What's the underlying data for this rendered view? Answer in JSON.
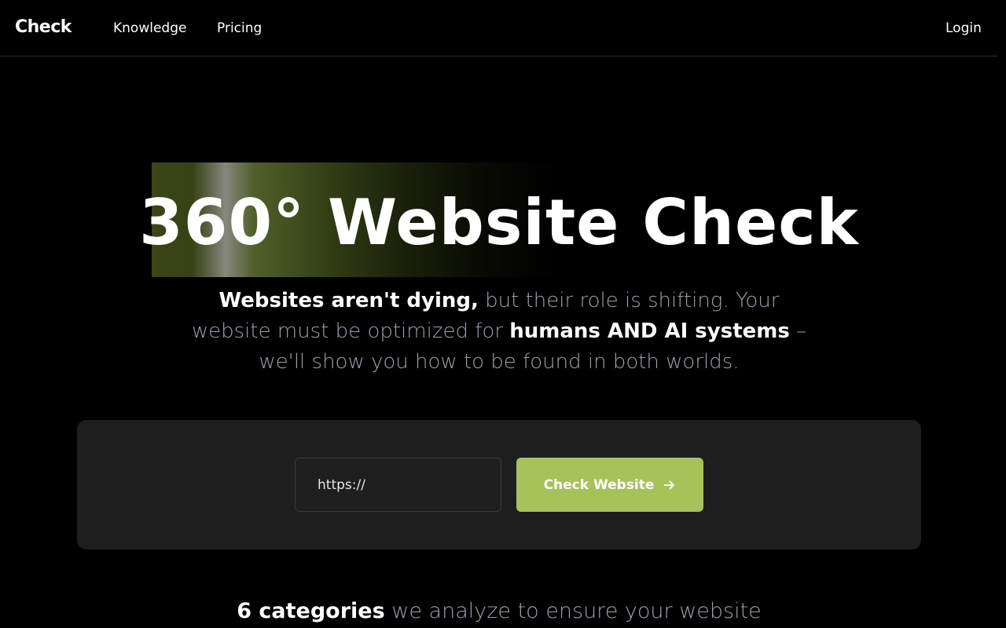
{
  "nav": {
    "brand": "Check",
    "links": [
      {
        "label": "Knowledge"
      },
      {
        "label": "Pricing"
      }
    ],
    "login": "Login"
  },
  "hero": {
    "title": "360° Website Check",
    "subtitle": {
      "part1_bold": "Websites aren't dying,",
      "part2": " but their role is shifting. Your website must be optimized for ",
      "part3_bold": "humans AND AI systems",
      "part4": " – we'll show you how to be found in both worlds."
    }
  },
  "check_form": {
    "input_placeholder": "https://",
    "input_value": "",
    "button_label": "Check Website",
    "button_icon": "arrow-right-icon"
  },
  "categories": {
    "bold": "6 categories",
    "rest": " we analyze to ensure your website"
  },
  "colors": {
    "background": "#000000",
    "panel": "#1e1e1e",
    "accent": "#a6c35a",
    "muted_text": "#9aa0b2",
    "nav_border": "#2a2a3a"
  }
}
